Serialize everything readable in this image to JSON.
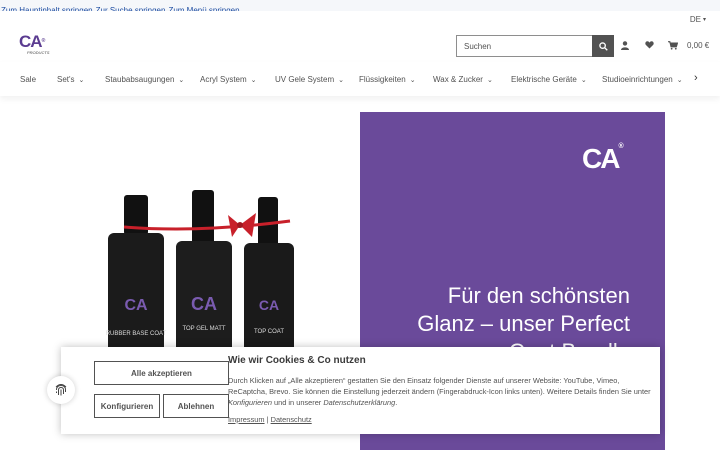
{
  "skip_links": [
    "Zum Hauptinhalt springen",
    "Zur Suche springen",
    "Zum Menü springen"
  ],
  "header": {
    "language": "DE",
    "logo_text": "CA",
    "logo_sub": "PRODUCTS",
    "search_placeholder": "Suchen",
    "cart_total": "0,00 €"
  },
  "nav": {
    "items": [
      {
        "label": "Sale",
        "dropdown": false
      },
      {
        "label": "Set's",
        "dropdown": true
      },
      {
        "label": "Staubabsaugungen",
        "dropdown": true
      },
      {
        "label": "Acryl System",
        "dropdown": true
      },
      {
        "label": "UV Gele System",
        "dropdown": true
      },
      {
        "label": "Flüssigkeiten",
        "dropdown": true
      },
      {
        "label": "Wax & Zucker",
        "dropdown": true
      },
      {
        "label": "Elektrische Geräte",
        "dropdown": true
      },
      {
        "label": "Studioeinrichtungen",
        "dropdown": true
      }
    ]
  },
  "hero": {
    "logo_text": "CA",
    "headline_line1": "Für den schönsten",
    "headline_line2": "Glanz – unser Perfect",
    "headline_line3": "Coat Bundle",
    "bottles": [
      "RUBBER BASE COAT",
      "TOP GEL MATT",
      "TOP COAT"
    ],
    "bottle_brand": "CA",
    "accent_color": "#6a4a9a"
  },
  "cookie": {
    "title": "Wie wir Cookies & Co nutzen",
    "body_part1": "Durch Klicken auf „Alle akzeptieren“ gestatten Sie den Einsatz folgender Dienste auf unserer Website: YouTube, Vimeo, ReCaptcha, Brevo. Sie können die Einstellung jederzeit ändern (Fingerabdruck-Icon links unten). Weitere Details finden Sie unter ",
    "body_link1": "Konfigurieren",
    "body_part2": " und in unserer ",
    "body_link2": "Datenschutzerklärung",
    "body_part3": ".",
    "accept_all_label": "Alle akzeptieren",
    "configure_label": "Konfigurieren",
    "decline_label": "Ablehnen",
    "imprint_label": "Impressum",
    "separator": "|",
    "privacy_label": "Datenschutz"
  }
}
